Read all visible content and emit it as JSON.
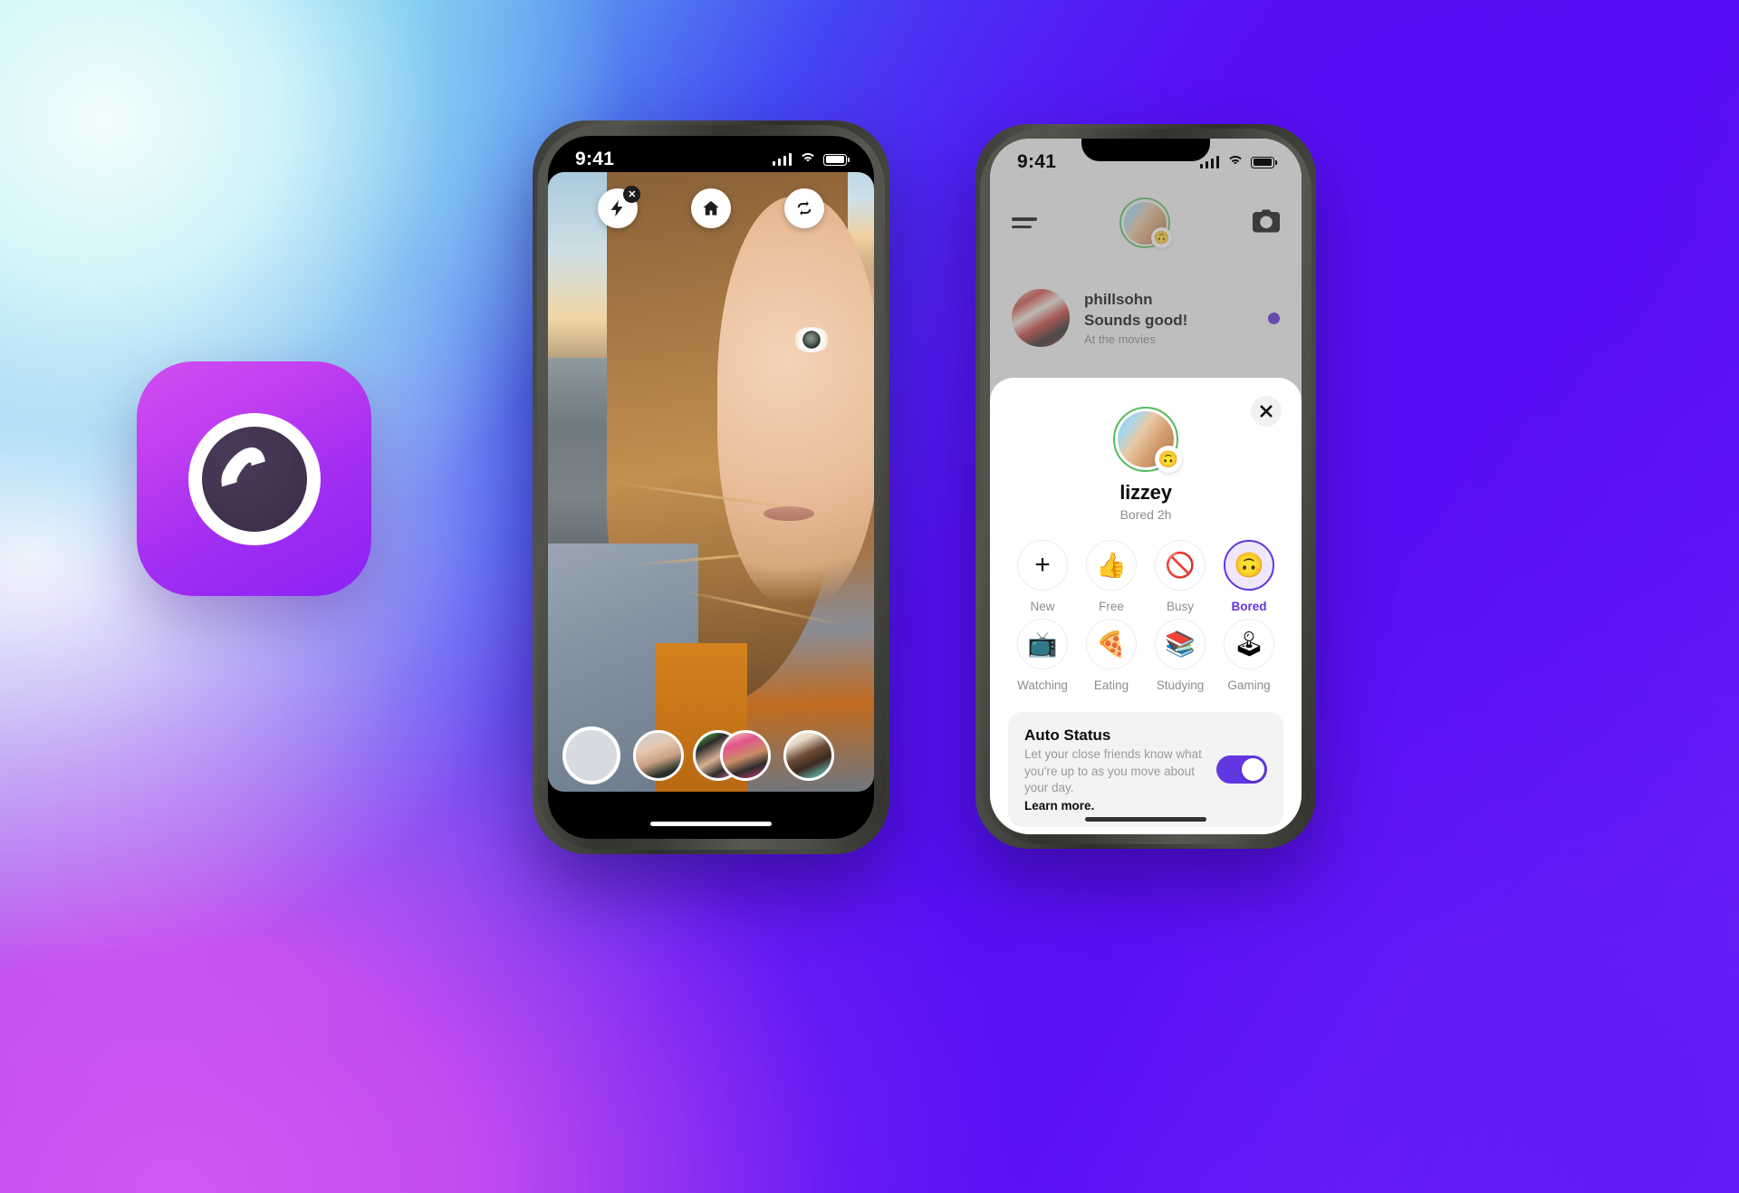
{
  "background": {
    "gradient_from": "#9fe8f2",
    "gradient_mid": "#5412f4",
    "gradient_to": "#c14cf0"
  },
  "app_icon": {
    "name": "threads-camera-app-icon",
    "gradient_start": "#d24ef0",
    "gradient_end": "#8b22f3",
    "lens_color": "#443450"
  },
  "center_phone": {
    "status_bar": {
      "time": "9:41",
      "signal": "signal-bars-icon",
      "wifi": "wifi-icon",
      "battery": "battery-full-icon"
    },
    "camera_controls": [
      {
        "name": "flash-off-button",
        "icon": "lightning-bolt-icon",
        "badge": "✕"
      },
      {
        "name": "home-button",
        "icon": "home-icon"
      },
      {
        "name": "flip-camera-button",
        "icon": "camera-flip-icon"
      }
    ],
    "shutter": {
      "label": "shutter-button"
    },
    "friends": [
      {
        "name": "friend-avatar-1"
      },
      {
        "name": "friend-avatar-2"
      },
      {
        "name": "friend-avatar-3"
      },
      {
        "name": "friend-avatar-4"
      }
    ]
  },
  "right_phone": {
    "status_bar": {
      "time": "9:41"
    },
    "header": {
      "menu": "hamburger-menu-icon",
      "avatar_badge": "🙃",
      "camera": "camera-icon"
    },
    "feed_row": {
      "username": "phillsohn",
      "message": "Sounds good!",
      "status": "At the movies",
      "unread_color": "#5b2ad4"
    },
    "sheet": {
      "close_label": "close-sheet",
      "profile": {
        "name": "lizzey",
        "status": "Bored 2h",
        "badge_emoji": "🙃",
        "ring_color": "#56bb5c"
      },
      "statuses": [
        {
          "label": "New",
          "emoji": "",
          "icon": "plus-icon",
          "selected": false
        },
        {
          "label": "Free",
          "emoji": "👍",
          "selected": false
        },
        {
          "label": "Busy",
          "emoji": "🚫",
          "selected": false
        },
        {
          "label": "Bored",
          "emoji": "🙃",
          "selected": true
        },
        {
          "label": "Watching",
          "emoji": "📺",
          "selected": false
        },
        {
          "label": "Eating",
          "emoji": "🍕",
          "selected": false
        },
        {
          "label": "Studying",
          "emoji": "📚",
          "selected": false
        },
        {
          "label": "Gaming",
          "emoji": "🕹",
          "selected": false
        }
      ],
      "accent_color": "#6236e0",
      "auto_status": {
        "title": "Auto Status",
        "description": "Let your close friends know what you're up to as you move about your day.",
        "learn_more": "Learn more.",
        "toggle_on": true,
        "toggle_color": "#6236e0"
      }
    }
  }
}
